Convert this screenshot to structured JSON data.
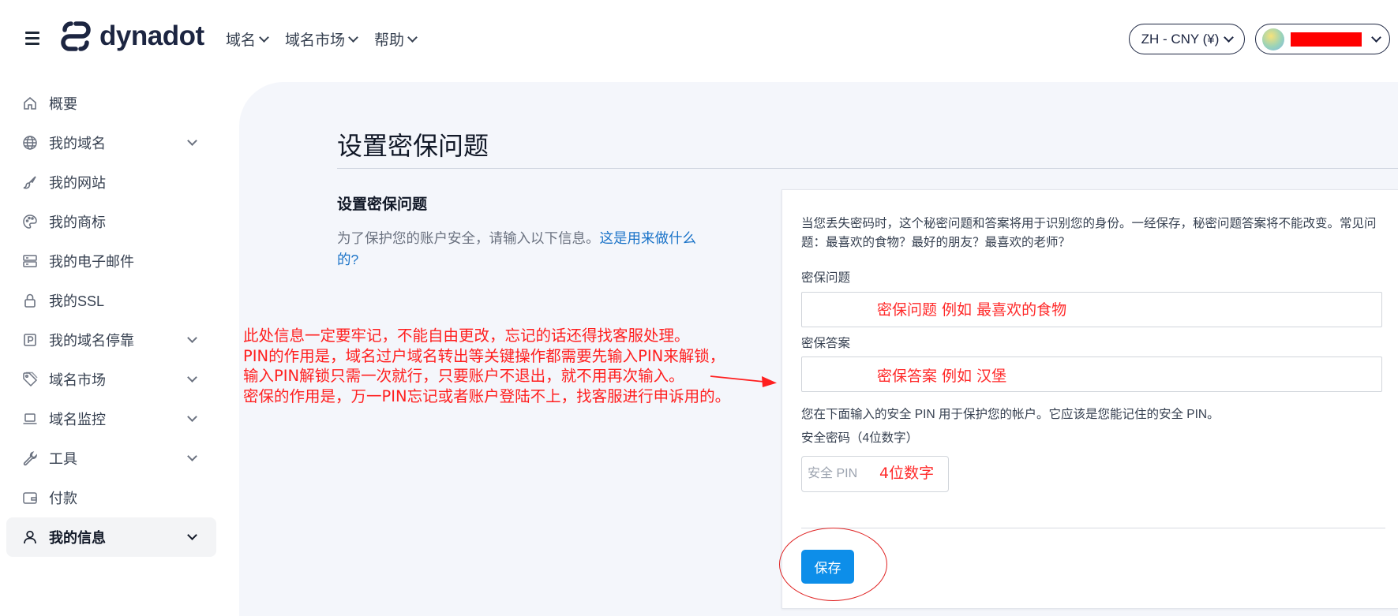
{
  "header": {
    "logo_text": "dynadot",
    "nav": [
      {
        "label": "域名"
      },
      {
        "label": "域名市场"
      },
      {
        "label": "帮助"
      }
    ],
    "language": "ZH - CNY (¥)"
  },
  "sidebar": {
    "items": [
      {
        "label": "概要",
        "icon": "home-icon"
      },
      {
        "label": "我的域名",
        "icon": "globe-icon"
      },
      {
        "label": "我的网站",
        "icon": "brush-icon"
      },
      {
        "label": "我的商标",
        "icon": "palette-icon"
      },
      {
        "label": "我的电子邮件",
        "icon": "server-icon"
      },
      {
        "label": "我的SSL",
        "icon": "lock-icon"
      },
      {
        "label": "我的域名停靠",
        "icon": "parking-icon"
      },
      {
        "label": "域名市场",
        "icon": "tag-icon"
      },
      {
        "label": "域名监控",
        "icon": "laptop-icon"
      },
      {
        "label": "工具",
        "icon": "wrench-icon"
      },
      {
        "label": "付款",
        "icon": "wallet-icon"
      },
      {
        "label": "我的信息",
        "icon": "user-icon"
      }
    ]
  },
  "main": {
    "page_title": "设置密保问题",
    "section_title": "设置密保问题",
    "section_desc": "为了保护您的账户安全，请输入以下信息。",
    "section_link": "这是用来做什么的?",
    "card": {
      "info": "当您丢失密码时，这个秘密问题和答案将用于识别您的身份。一经保存，秘密问题答案将不能改变。常见问题：最喜欢的食物？最好的朋友？最喜欢的老师？",
      "question_label": "密保问题",
      "answer_label": "密保答案",
      "pin_info": "您在下面输入的安全 PIN 用于保护您的帐户。它应该是您能记住的安全 PIN。",
      "pin_label": "安全密码（4位数字）",
      "pin_placeholder": "安全 PIN",
      "save_label": "保存"
    }
  },
  "annotations": {
    "question_hint": "密保问题 例如 最喜欢的食物",
    "answer_hint": "密保答案 例如 汉堡",
    "pin_hint": "4位数字",
    "note_lines": [
      "此处信息一定要牢记，不能自由更改，忘记的话还得找客服处理。",
      "PIN的作用是，域名过户域名转出等关键操作都需要先输入PIN来解锁，",
      "输入PIN解锁只需一次就行，只要账户不退出，就不用再次输入。",
      "密保的作用是，万一PIN忘记或者账户登陆不上，找客服进行申诉用的。"
    ],
    "color": "#ff1f1f"
  }
}
